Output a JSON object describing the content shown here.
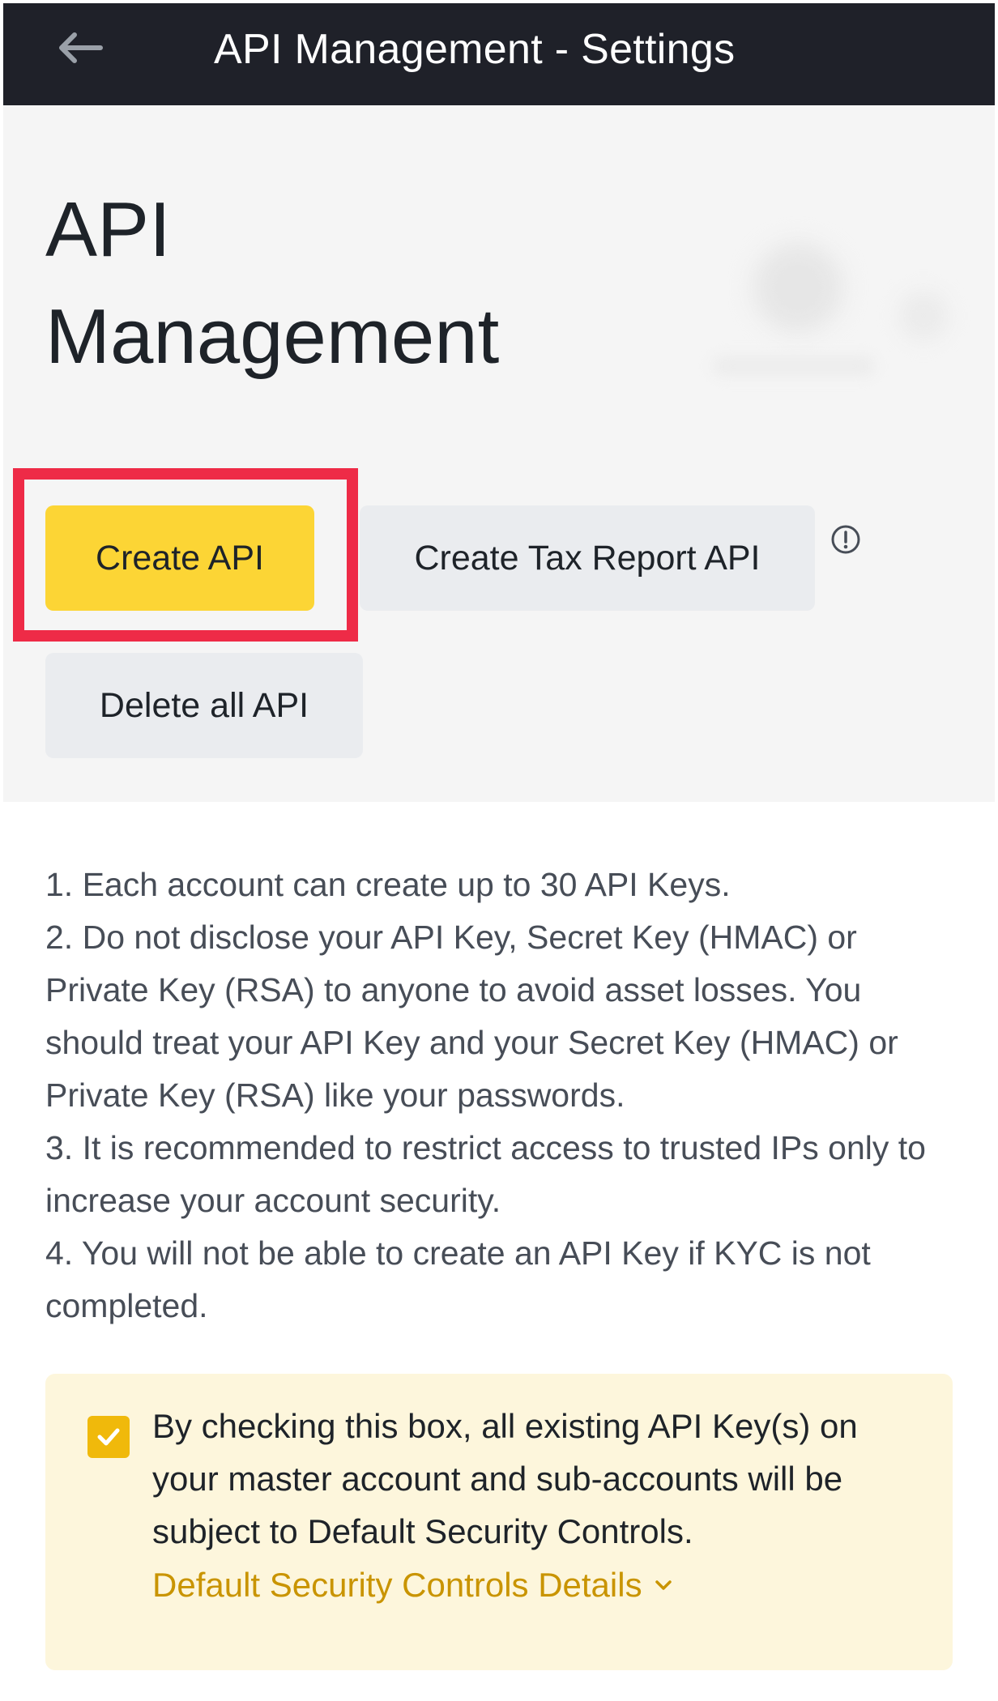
{
  "topbar": {
    "title": "API Management - Settings",
    "back_icon": "back-arrow-icon"
  },
  "header": {
    "title_line1": "API",
    "title_line2": "Management"
  },
  "actions": {
    "create_label": "Create API",
    "tax_label": "Create Tax Report API",
    "delete_label": "Delete all API",
    "info_icon": "info-icon"
  },
  "notes": [
    "1. Each account can create up to 30 API Keys.",
    "2. Do not disclose your API Key, Secret Key (HMAC) or Private Key (RSA) to anyone to avoid asset losses. You should treat your API Key and your Secret Key (HMAC) or Private Key (RSA) like your passwords.",
    "3. It is recommended to restrict access to trusted IPs only to increase your account security.",
    "4. You will not be able to create an API Key if KYC is not completed."
  ],
  "consent": {
    "checked": true,
    "text": "By checking this box, all existing API Key(s) on your master account and sub-accounts will be subject to Default Security Controls.",
    "link_label": "Default Security Controls Details"
  },
  "colors": {
    "accent": "#fcd535",
    "highlight": "#ee2b47",
    "link": "#c99400",
    "topbar": "#1f2129"
  }
}
